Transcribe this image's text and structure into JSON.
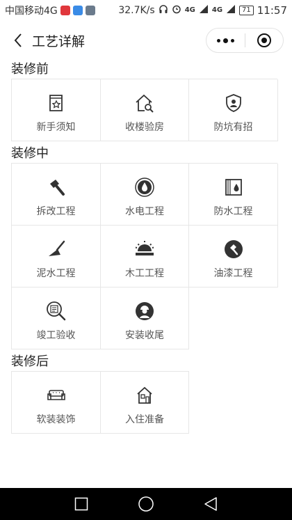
{
  "status_bar": {
    "carrier": "中国移动4G",
    "net_speed": "32.7K/s",
    "signal_top": "4G",
    "signal_bottom": "4G",
    "battery": "71",
    "time": "11:57"
  },
  "header": {
    "title": "工艺详解"
  },
  "sections": [
    {
      "title": "装修前",
      "items": [
        {
          "label": "新手须知",
          "icon": "book-star-icon"
        },
        {
          "label": "收楼验房",
          "icon": "house-search-icon"
        },
        {
          "label": "防坑有招",
          "icon": "shield-user-icon"
        }
      ]
    },
    {
      "title": "装修中",
      "items": [
        {
          "label": "拆改工程",
          "icon": "hammer-icon"
        },
        {
          "label": "水电工程",
          "icon": "water-drop-circle-icon"
        },
        {
          "label": "防水工程",
          "icon": "waterproof-icon"
        },
        {
          "label": "泥水工程",
          "icon": "trowel-icon"
        },
        {
          "label": "木工工程",
          "icon": "saw-icon"
        },
        {
          "label": "油漆工程",
          "icon": "paint-circle-icon"
        },
        {
          "label": "竣工验收",
          "icon": "magnifier-check-icon"
        },
        {
          "label": "安装收尾",
          "icon": "worker-circle-icon"
        }
      ]
    },
    {
      "title": "装修后",
      "items": [
        {
          "label": "软装装饰",
          "icon": "sofa-icon"
        },
        {
          "label": "入住准备",
          "icon": "home-icon"
        }
      ]
    }
  ]
}
